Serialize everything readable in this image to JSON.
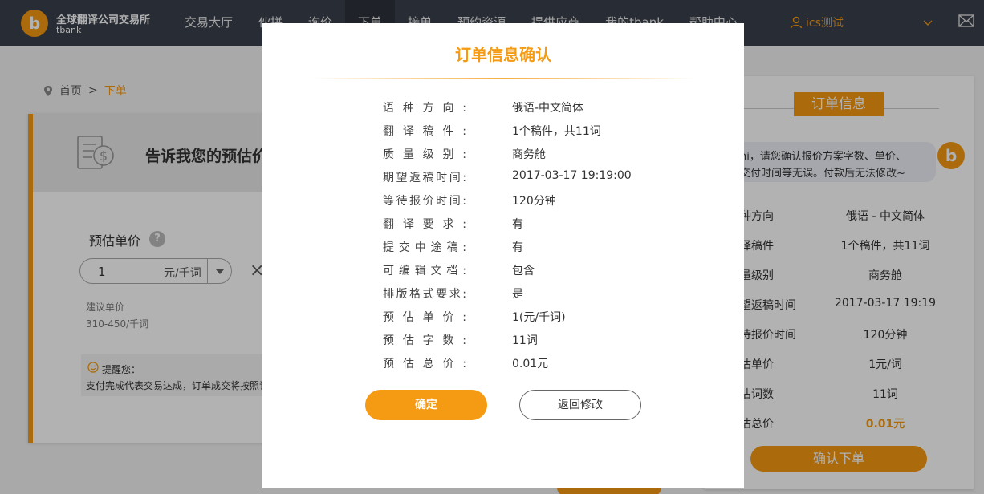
{
  "header": {
    "logo_title": "全球翻译公司交易所",
    "logo_sub": "tbank",
    "nav": [
      "交易大厅",
      "伙拼",
      "询价",
      "下单",
      "接单",
      "预约资源",
      "提供应商",
      "我的tbank",
      "帮助中心"
    ],
    "user_name": "ics测试"
  },
  "breadcrumb": {
    "home": "首页",
    "sep": ">",
    "current": "下单"
  },
  "left_card": {
    "title": "告诉我您的预估价",
    "price_label": "预估单价",
    "price_value": "1",
    "price_unit": "元/千词",
    "suggest_label": "建议单价",
    "suggest_range": "310-450/千词",
    "tip_title": "提醒您：",
    "tip_body": "支付完成代表交易达成，订单成交将按照订"
  },
  "right_card": {
    "badge": "订单信息",
    "bubble_line1": "hi，请您确认报价方案字数、单价、",
    "bubble_line2": "交付时间等无误。付款后无法修改~",
    "rows": [
      {
        "k": "语种方向",
        "v": "俄语 - 中文简体"
      },
      {
        "k": "翻译稿件",
        "v": "1个稿件，共11词"
      },
      {
        "k": "质量级别",
        "v": "商务舱"
      },
      {
        "k": "期望返稿时间",
        "v": "2017-03-17 19:19"
      },
      {
        "k": "等待报价时间",
        "v": "120分钟"
      },
      {
        "k": "预估单价",
        "v": "1元/词"
      },
      {
        "k": "预估词数",
        "v": "11词"
      },
      {
        "k": "预估总价",
        "v": "0.01元"
      }
    ],
    "confirm_button": "确认下单"
  },
  "modal": {
    "title": "订单信息确认",
    "rows": [
      {
        "k": "语种方向:",
        "v": "俄语-中文简体"
      },
      {
        "k": "翻译稿件:",
        "v": "1个稿件，共11词"
      },
      {
        "k": "质量级别:",
        "v": "商务舱"
      },
      {
        "k": "期望返稿时间:",
        "v": "2017-03-17 19:19:00"
      },
      {
        "k": "等待报价时间:",
        "v": "120分钟"
      },
      {
        "k": "翻译要求:",
        "v": "有"
      },
      {
        "k": "提交中途稿:",
        "v": "有"
      },
      {
        "k": "可编辑文档:",
        "v": "包含"
      },
      {
        "k": "排版格式要求:",
        "v": "是"
      },
      {
        "k": "预估单价:",
        "v": "1(元/千词)"
      },
      {
        "k": "预估字数:",
        "v": "11词"
      },
      {
        "k": "预估总价:",
        "v": "0.01元"
      }
    ],
    "ok_button": "确定",
    "back_button": "返回修改"
  },
  "colors": {
    "accent": "#f59a13",
    "nav_bg": "#3a3f4b"
  }
}
